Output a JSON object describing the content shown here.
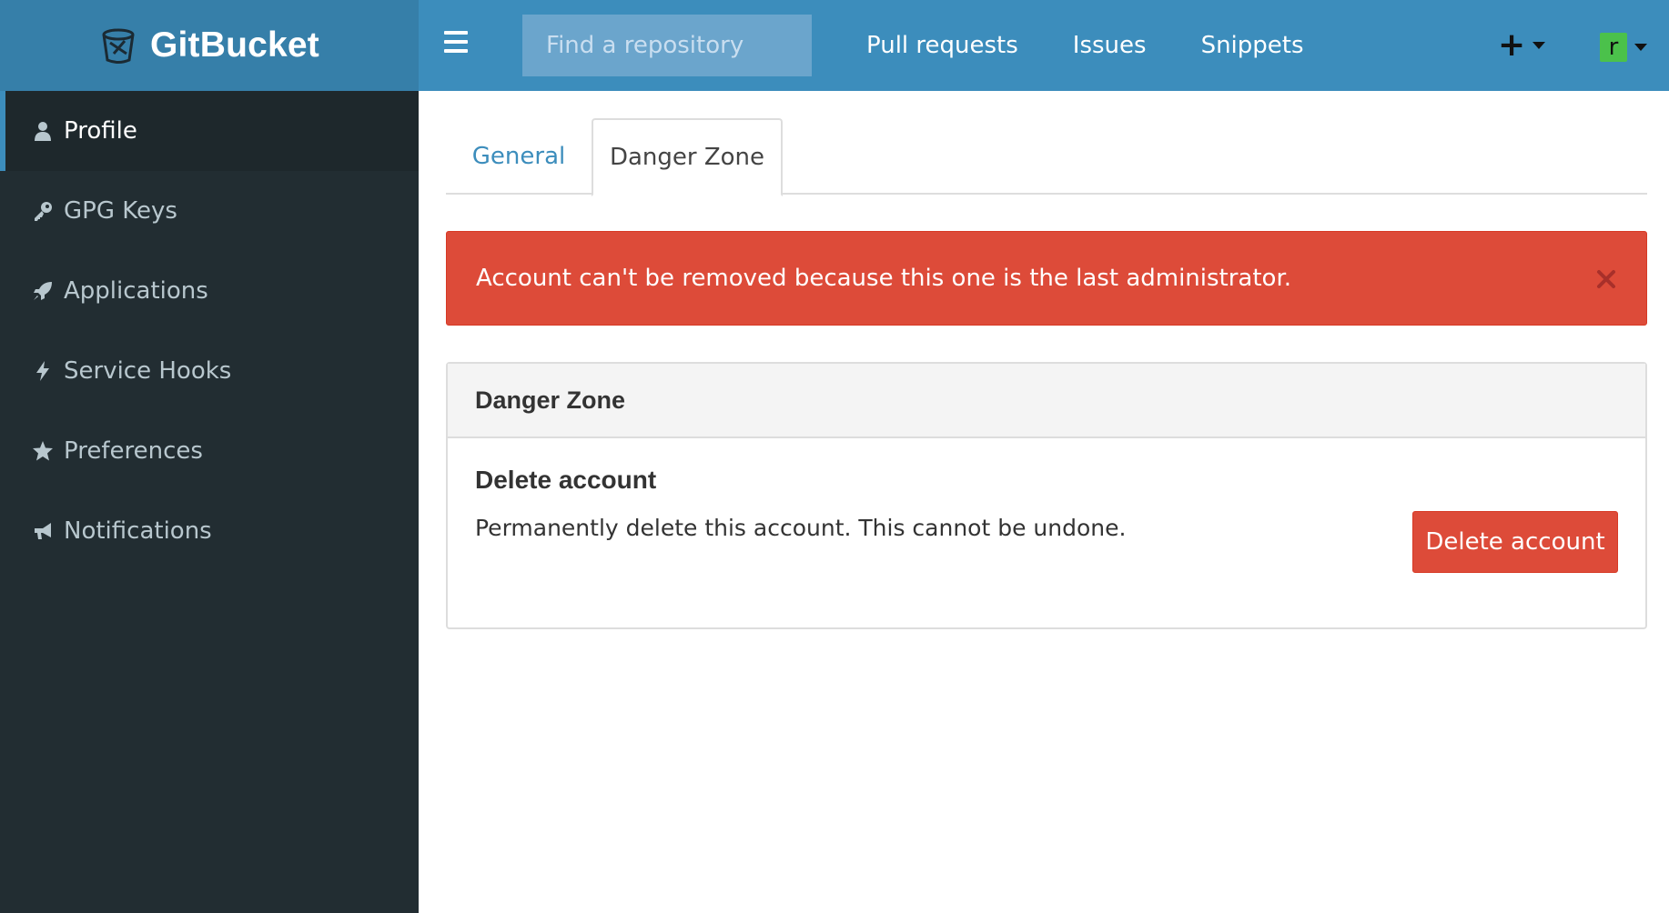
{
  "brand": {
    "name": "GitBucket"
  },
  "colors": {
    "header_blue": "#3c8dbc",
    "logo_blue": "#367fa9",
    "sidebar_dark": "#222d32",
    "danger_red": "#dd4b39",
    "avatar_green": "#4bc14b"
  },
  "sidebar": {
    "items": [
      {
        "label": "Profile",
        "icon": "user-icon",
        "active": true
      },
      {
        "label": "GPG Keys",
        "icon": "key-icon"
      },
      {
        "label": "Applications",
        "icon": "rocket-icon"
      },
      {
        "label": "Service Hooks",
        "icon": "bolt-icon"
      },
      {
        "label": "Preferences",
        "icon": "star-icon"
      },
      {
        "label": "Notifications",
        "icon": "bullhorn-icon"
      }
    ]
  },
  "header": {
    "search_placeholder": "Find a repository",
    "nav": [
      "Pull requests",
      "Issues",
      "Snippets"
    ],
    "plus_label": "+",
    "user_initial": "r"
  },
  "tabs": [
    {
      "label": "General"
    },
    {
      "label": "Danger Zone",
      "active": true
    }
  ],
  "alert": {
    "message": "Account can't be removed because this one is the last administrator."
  },
  "danger_box": {
    "header": "Danger Zone",
    "title": "Delete account",
    "description": "Permanently delete this account. This cannot be undone.",
    "button_label": "Delete account"
  }
}
